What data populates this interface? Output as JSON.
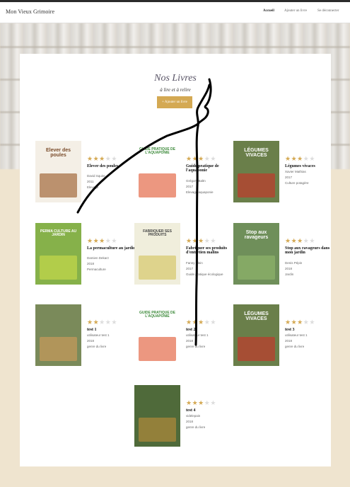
{
  "header": {
    "brand": "Mon Vieux Grimoire",
    "nav": [
      {
        "label": "Accueil",
        "active": true
      },
      {
        "label": "Ajouter un livre",
        "active": false
      },
      {
        "label": "Se déconnecter",
        "active": false
      }
    ]
  },
  "main": {
    "title": "Nos Livres",
    "subtitle": "à lire et à relire",
    "add_button": "+ Ajouter un livre"
  },
  "books": [
    {
      "title": "Elever des poules",
      "author": "David Squire",
      "year": "2011",
      "genre": "Elevage",
      "rating": 3
    },
    {
      "title": "Guide pratique de l'aquaponie",
      "author": "Grégory Baltn",
      "year": "2017",
      "genre": "Elevage aquaponie",
      "rating": 3
    },
    {
      "title": "Légumes vivaces",
      "author": "Xavier Mathias",
      "year": "2017",
      "genre": "Culture potagère",
      "rating": 3
    },
    {
      "title": "La permaculture au jardin",
      "author": "Damien Dekarz",
      "year": "2018",
      "genre": "Permaculture",
      "rating": 3
    },
    {
      "title": "Fabriquer ses produits d'entretien malins",
      "author": "Fanny Blein",
      "year": "2017",
      "genre": "Guide pratique écologique",
      "rating": 3
    },
    {
      "title": "Stop aux ravageurs dans mon jardin",
      "author": "Denis Pépin",
      "year": "2018",
      "genre": "Jardin",
      "rating": 3
    },
    {
      "title": "test 1",
      "author": "utilisateur test 1",
      "year": "2018",
      "genre": "genre du livre",
      "rating": 2
    },
    {
      "title": "test 2",
      "author": "utilisateur test 1",
      "year": "2018",
      "genre": "genre du livre",
      "rating": 3
    },
    {
      "title": "test 3",
      "author": "utilisateur test 1",
      "year": "2018",
      "genre": "genre du livre",
      "rating": 3
    },
    {
      "title": "test 4",
      "author": "videlepain",
      "year": "2018",
      "genre": "genre du livre",
      "rating": 3
    }
  ],
  "covers": [
    {
      "text": "Elever des poules",
      "bg": "#f4efe6",
      "fg": "#7a4b2a",
      "accent": "#a36a3a"
    },
    {
      "text": "GUIDE PRATIQUE DE L'AQUAPONIE",
      "bg": "#ffffff",
      "fg": "#3c8a3a",
      "accent": "#e46b4a"
    },
    {
      "text": "LÉGUMES VIVACES",
      "bg": "#6a7f4a",
      "fg": "#ffffff",
      "accent": "#c0392b"
    },
    {
      "text": "PERMA CULTURE AU JARDIN",
      "bg": "#86b14a",
      "fg": "#ffffff",
      "accent": "#c4d84a"
    },
    {
      "text": "FABRIQUER SES PRODUITS",
      "bg": "#f0eedc",
      "fg": "#444444",
      "accent": "#d6c76a"
    },
    {
      "text": "Stop aux ravageurs",
      "bg": "#6f8f5a",
      "fg": "#ffffff",
      "accent": "#8fb46a"
    },
    {
      "text": "",
      "bg": "#7a8a5a",
      "fg": "#ffffff",
      "accent": "#c99a5a"
    },
    {
      "text": "GUIDE PRATIQUE DE L'AQUAPONIE",
      "bg": "#ffffff",
      "fg": "#3c8a3a",
      "accent": "#e46b4a"
    },
    {
      "text": "LÉGUMES VIVACES",
      "bg": "#6a7f4a",
      "fg": "#ffffff",
      "accent": "#c0392b"
    },
    {
      "text": "",
      "bg": "#4f6a3a",
      "fg": "#ffffff",
      "accent": "#b08a3a"
    }
  ],
  "colors": {
    "accent": "#d4a953",
    "background": "#efe4cf",
    "title": "#595466"
  }
}
